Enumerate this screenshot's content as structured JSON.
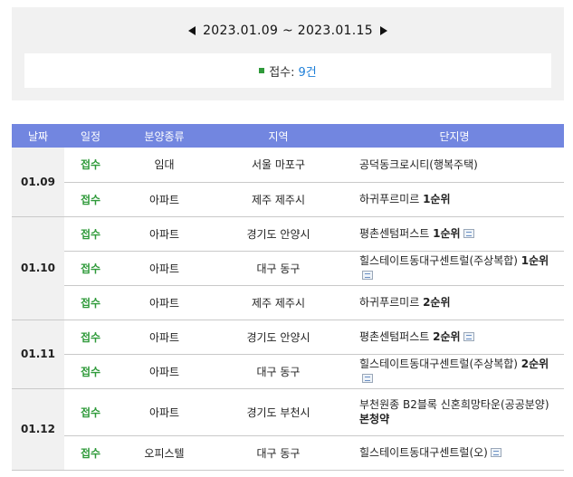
{
  "week_nav": {
    "range": "2023.01.09 ~ 2023.01.15"
  },
  "summary": {
    "label": "접수:",
    "count": "9건"
  },
  "table": {
    "headers": [
      "날짜",
      "일정",
      "분양종류",
      "지역",
      "단지명"
    ],
    "groups": [
      {
        "date": "01.09",
        "rows": [
          {
            "status": "접수",
            "type": "임대",
            "region": "서울 마포구",
            "name": "공덕동크로시티(행복주택)",
            "round": "",
            "icon": false
          },
          {
            "status": "접수",
            "type": "아파트",
            "region": "제주 제주시",
            "name": "하귀푸르미르",
            "round": "1순위",
            "icon": false
          }
        ]
      },
      {
        "date": "01.10",
        "rows": [
          {
            "status": "접수",
            "type": "아파트",
            "region": "경기도 안양시",
            "name": "평촌센텀퍼스트",
            "round": "1순위",
            "icon": true
          },
          {
            "status": "접수",
            "type": "아파트",
            "region": "대구 동구",
            "name": "힐스테이트동대구센트럴(주상복합)",
            "round": "1순위",
            "icon": true
          },
          {
            "status": "접수",
            "type": "아파트",
            "region": "제주 제주시",
            "name": "하귀푸르미르",
            "round": "2순위",
            "icon": false
          }
        ]
      },
      {
        "date": "01.11",
        "rows": [
          {
            "status": "접수",
            "type": "아파트",
            "region": "경기도 안양시",
            "name": "평촌센텀퍼스트",
            "round": "2순위",
            "icon": true
          },
          {
            "status": "접수",
            "type": "아파트",
            "region": "대구 동구",
            "name": "힐스테이트동대구센트럴(주상복합)",
            "round": "2순위",
            "icon": true
          }
        ]
      },
      {
        "date": "01.12",
        "rows": [
          {
            "status": "접수",
            "type": "아파트",
            "region": "경기도 부천시",
            "name": "부천원종 B2블록 신혼희망타운(공공분양)",
            "round": "본청약",
            "icon": false
          },
          {
            "status": "접수",
            "type": "오피스텔",
            "region": "대구 동구",
            "name": "힐스테이트동대구센트럴(오)",
            "round": "",
            "icon": true
          }
        ]
      }
    ]
  },
  "colors": {
    "header_bg": "#7286e0",
    "status_green": "#2f9a3a",
    "count_blue": "#1e7fd8",
    "panel_bg": "#f1f1f1"
  }
}
